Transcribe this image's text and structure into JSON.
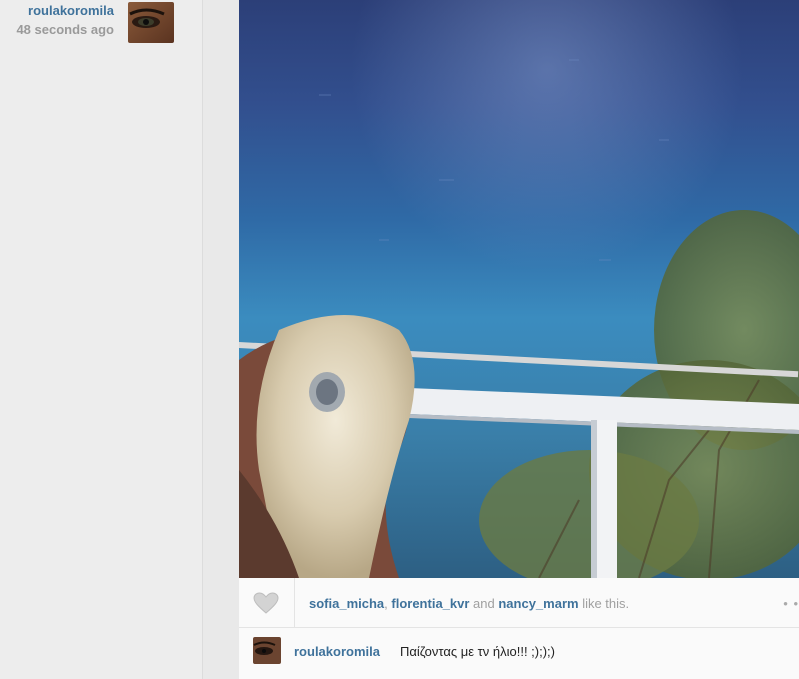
{
  "post": {
    "author": "roulakoromila",
    "time_ago": "48 seconds ago"
  },
  "likes": {
    "users": [
      "sofia_micha",
      "florentia_kvr",
      "nancy_marm"
    ],
    "separator": ", ",
    "and_text": " and ",
    "suffix": " like this.",
    "more": "• •"
  },
  "caption": {
    "user": "roulakoromila",
    "text": "Παίζοντας με τν ήλιο!!! ;););)"
  },
  "icons": {
    "like": "heart-icon",
    "avatar": "user-avatar"
  },
  "colors": {
    "username": "#3f729b",
    "muted": "#9a9a9a",
    "background": "#ededed"
  }
}
